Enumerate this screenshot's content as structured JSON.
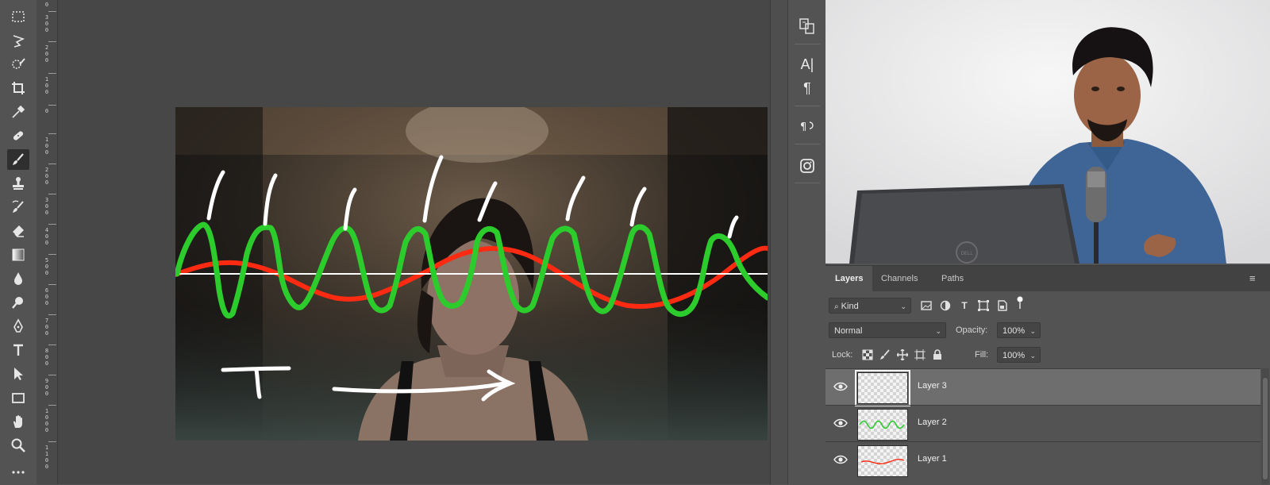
{
  "toolbar": {
    "tools": [
      "rectangular-marquee",
      "lasso",
      "quick-selection",
      "crop",
      "eyedropper",
      "healing-brush",
      "brush",
      "clone-stamp",
      "history-brush",
      "eraser",
      "gradient",
      "blur",
      "dodge",
      "pen",
      "type",
      "path-selection",
      "rectangle",
      "hand",
      "zoom",
      "more-tools"
    ],
    "active_tool": "brush"
  },
  "ruler": {
    "labels": [
      "0",
      "3\n0\n0",
      "2\n0\n0",
      "1\n0\n0",
      "0",
      "1\n0\n0",
      "2\n0\n0",
      "3\n0\n0",
      "4\n0\n0",
      "5\n0\n0",
      "6\n0\n0",
      "7\n0\n0",
      "8\n0\n0",
      "9\n0\n0",
      "1\n0\n0\n0",
      "1\n1\n0\n0"
    ]
  },
  "canvas": {
    "colors": {
      "red": "#ff2a12",
      "green": "#2bcc2b",
      "white": "#ffffff"
    },
    "annotation_text": "T"
  },
  "dock": {
    "icons": [
      "clone-source-icon",
      "character-icon",
      "paragraph-icon",
      "paragraph-styles-icon",
      "instagram-icon"
    ],
    "labels": {
      "character": "A|",
      "paragraph": "¶"
    }
  },
  "layers_panel": {
    "tabs": [
      "Layers",
      "Channels",
      "Paths"
    ],
    "active_tab": "Layers",
    "filter": {
      "value": "Kind"
    },
    "blend_mode": "Normal",
    "opacity_label": "Opacity:",
    "opacity_value": "100%",
    "lock_label": "Lock:",
    "fill_label": "Fill:",
    "fill_value": "100%",
    "layers": [
      {
        "name": "Layer 3",
        "selected": true,
        "visible": true
      },
      {
        "name": "Layer 2",
        "selected": false,
        "visible": true
      },
      {
        "name": "Layer 1",
        "selected": false,
        "visible": true
      }
    ]
  },
  "webcam": {
    "laptop_logo": "DELL"
  }
}
